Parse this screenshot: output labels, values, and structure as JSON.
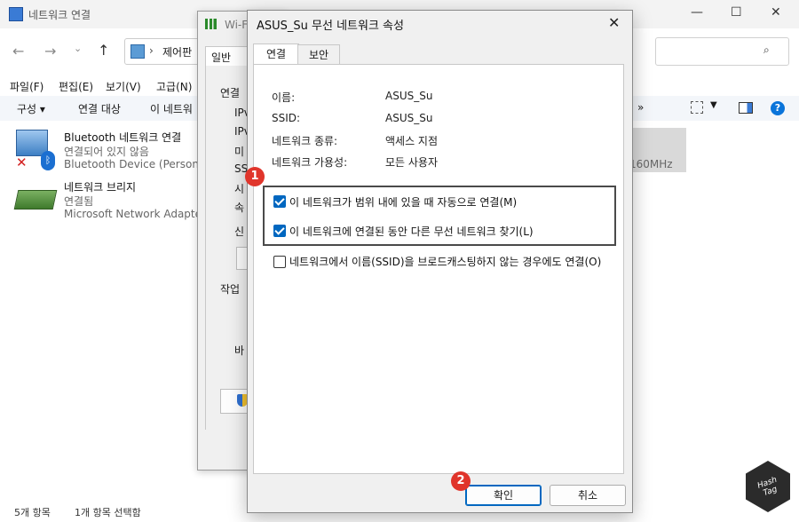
{
  "explorer": {
    "title": "네트워크 연결",
    "address": "제어판",
    "menu": [
      "파일(F)",
      "편집(E)",
      "보기(V)",
      "고급(N)"
    ],
    "commands": [
      "구성 ▾",
      "연결 대상",
      "이 네트워"
    ],
    "chevron": "»",
    "items": [
      {
        "name": "Bluetooth 네트워크 연결",
        "status": "연결되어 있지 않음",
        "device": "Bluetooth Device (Personal A"
      },
      {
        "name": "네트워크 브리지",
        "status": "연결됨",
        "device": "Microsoft Network Adapter"
      }
    ],
    "tile_text": "160MHz",
    "status_count": "5개 항목",
    "status_selected": "1개 항목 선택함"
  },
  "wifi_window": {
    "title": "Wi-F",
    "tab": "일반",
    "section": "연결",
    "rows": [
      "IPv",
      "IPv",
      "미",
      "SSI",
      "시",
      "속"
    ],
    "label_sin": "신",
    "section2": "작업",
    "label_ba": "바"
  },
  "dialog": {
    "title": "ASUS_Su 무선 네트워크 속성",
    "close": "✕",
    "tabs": [
      "연결",
      "보안"
    ],
    "info": [
      {
        "label": "이름:",
        "value": "ASUS_Su"
      },
      {
        "label": "SSID:",
        "value": "ASUS_Su"
      },
      {
        "label": "네트워크 종류:",
        "value": "액세스 지점"
      },
      {
        "label": "네트워크 가용성:",
        "value": "모든 사용자"
      }
    ],
    "options": [
      {
        "label": "이 네트워크가 범위 내에 있을 때 자동으로 연결(M)",
        "checked": true
      },
      {
        "label": "이 네트워크에 연결된 동안 다른 무선 네트워크 찾기(L)",
        "checked": true
      },
      {
        "label": "네트워크에서 이름(SSID)을 브로드캐스팅하지 않는 경우에도 연결(O)",
        "checked": false
      }
    ],
    "ok": "확인",
    "cancel": "취소"
  },
  "badges": [
    "1",
    "2"
  ],
  "watermark": "Hash Tag",
  "colors": {
    "accent": "#0067c0",
    "badge": "#e0352b"
  }
}
